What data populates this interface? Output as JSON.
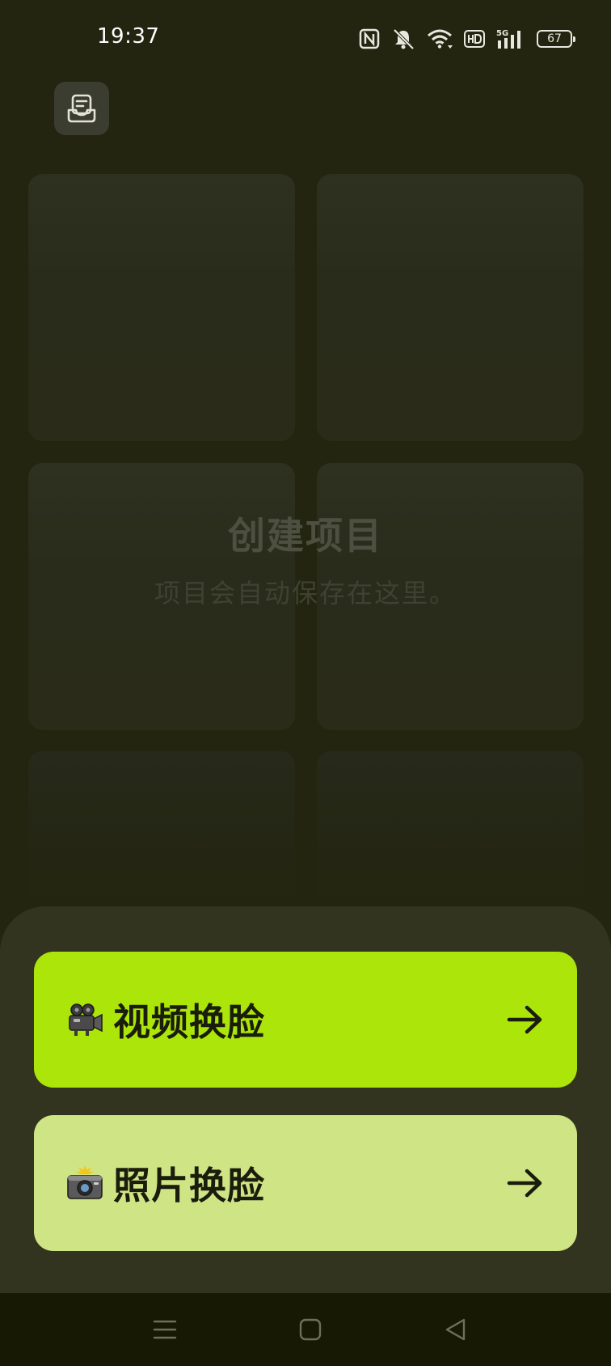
{
  "status_bar": {
    "time": "19:37",
    "battery": "67",
    "icons": [
      "nfc-icon",
      "mute-icon",
      "wifi-icon",
      "hd-icon",
      "5g-signal-icon",
      "battery-icon"
    ]
  },
  "header": {
    "inbox_icon": "inbox-tray-icon"
  },
  "empty_state": {
    "title": "创建项目",
    "subtitle": "项目会自动保存在这里。"
  },
  "actions": [
    {
      "label": "视频换脸",
      "emoji": "movie-camera-icon",
      "arrow": "arrow-right-icon",
      "color": "#ace509"
    },
    {
      "label": "照片换脸",
      "emoji": "camera-flash-icon",
      "arrow": "arrow-right-icon",
      "color": "#cfe485"
    }
  ],
  "colors": {
    "background": "#232510",
    "sheet": "#33341f",
    "primary_accent": "#ace509",
    "secondary_accent": "#cfe485"
  },
  "nav_bar": {
    "buttons": [
      "menu-icon",
      "home-icon",
      "back-icon"
    ]
  }
}
